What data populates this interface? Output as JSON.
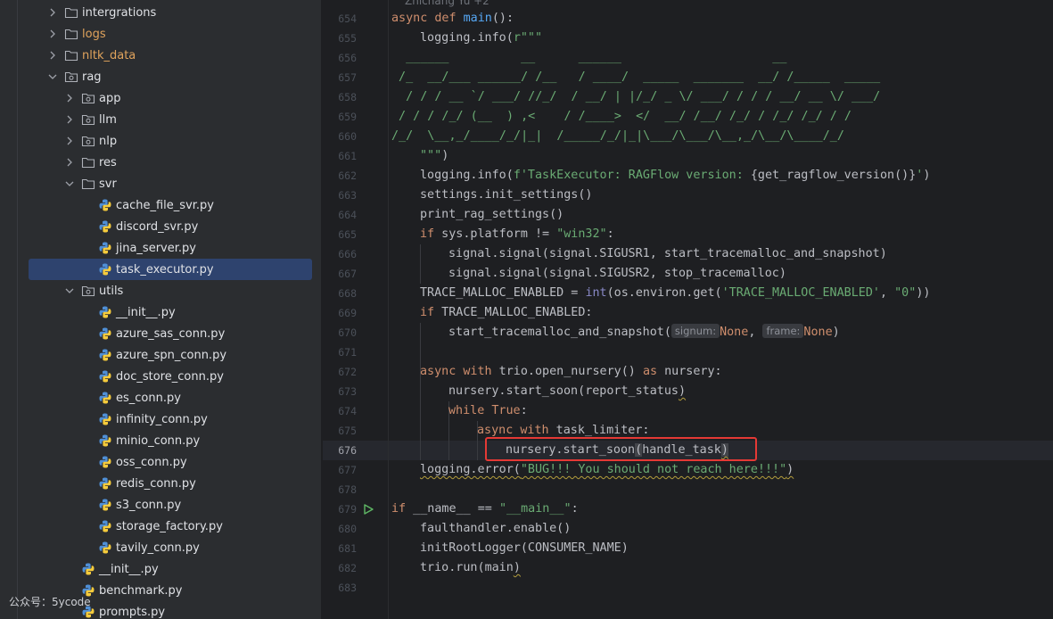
{
  "colors": {
    "sidebar_bg": "#2b2d30",
    "editor_bg": "#1e1f22",
    "selection": "#2e436e",
    "keyword": "#cf8e6d",
    "function": "#56a8f5",
    "string": "#6aab73",
    "highlight_box": "#e53935"
  },
  "sidebar": {
    "items": [
      {
        "label": "intergrations",
        "type": "folder",
        "expanded": false
      },
      {
        "label": "logs",
        "type": "folder",
        "expanded": false
      },
      {
        "label": "nltk_data",
        "type": "folder",
        "expanded": false
      },
      {
        "label": "rag",
        "type": "package",
        "expanded": true
      },
      {
        "label": "app",
        "type": "package",
        "expanded": false
      },
      {
        "label": "llm",
        "type": "package",
        "expanded": false
      },
      {
        "label": "nlp",
        "type": "package",
        "expanded": false
      },
      {
        "label": "res",
        "type": "folder",
        "expanded": false
      },
      {
        "label": "svr",
        "type": "folder",
        "expanded": true
      },
      {
        "label": "cache_file_svr.py",
        "type": "python-file"
      },
      {
        "label": "discord_svr.py",
        "type": "python-file"
      },
      {
        "label": "jina_server.py",
        "type": "python-file"
      },
      {
        "label": "task_executor.py",
        "type": "python-file",
        "selected": true
      },
      {
        "label": "utils",
        "type": "package",
        "expanded": true
      },
      {
        "label": "__init__.py",
        "type": "python-file"
      },
      {
        "label": "azure_sas_conn.py",
        "type": "python-file"
      },
      {
        "label": "azure_spn_conn.py",
        "type": "python-file"
      },
      {
        "label": "doc_store_conn.py",
        "type": "python-file"
      },
      {
        "label": "es_conn.py",
        "type": "python-file"
      },
      {
        "label": "infinity_conn.py",
        "type": "python-file"
      },
      {
        "label": "minio_conn.py",
        "type": "python-file"
      },
      {
        "label": "oss_conn.py",
        "type": "python-file"
      },
      {
        "label": "redis_conn.py",
        "type": "python-file"
      },
      {
        "label": "s3_conn.py",
        "type": "python-file"
      },
      {
        "label": "storage_factory.py",
        "type": "python-file"
      },
      {
        "label": "tavily_conn.py",
        "type": "python-file"
      },
      {
        "label": "__init__.py",
        "type": "python-file"
      },
      {
        "label": "benchmark.py",
        "type": "python-file"
      },
      {
        "label": "prompts.py",
        "type": "python-file"
      }
    ]
  },
  "editor": {
    "author_hint": "Zhichang Yu +2",
    "current_line": "676",
    "line_numbers": [
      "654",
      "655",
      "656",
      "657",
      "658",
      "659",
      "660",
      "661",
      "662",
      "663",
      "664",
      "665",
      "666",
      "667",
      "668",
      "669",
      "670",
      "671",
      "672",
      "673",
      "674",
      "675",
      "676",
      "677",
      "678",
      "679",
      "680",
      "681",
      "682",
      "683"
    ],
    "code": {
      "l654": [
        "async",
        " ",
        "def",
        " ",
        "main",
        "():"
      ],
      "l655": [
        "logging.info(",
        "r\"\"\""
      ],
      "l656": "  ______          __      ______                     __",
      "l657": " /_  __/___ ______/ /__   / ____/  _____  _______  __/ /_____  _____",
      "l658": "  / / / __ `/ ___/ //_/  / __/ | |/_/ _ \\/ ___/ / / / __/ __ \\/ ___/",
      "l659": " / / / /_/ (__  ) ,<    / /____>  </  __/ /__/ /_/ / /_/ /_/ / /",
      "l660": "/_/  \\__,_/____/_/|_|  /_____/_/|_|\\___/\\___/\\__,_/\\__/\\____/_/",
      "l661": "\"\"\"",
      "l661_close": ")",
      "l662": [
        "logging.info(",
        "f'TaskExecutor: RAGFlow version: ",
        "{get_ragflow_version()}",
        "'",
        ")"
      ],
      "l663": "settings.init_settings()",
      "l664": "print_rag_settings()",
      "l665": [
        "if",
        " sys.platform != ",
        "\"win32\"",
        ":"
      ],
      "l666": "signal.signal(signal.SIGUSR1, start_tracemalloc_and_snapshot)",
      "l667": "signal.signal(signal.SIGUSR2, stop_tracemalloc)",
      "l668": [
        "TRACE_MALLOC_ENABLED = ",
        "int",
        "(os.environ.get(",
        "'TRACE_MALLOC_ENABLED'",
        ", ",
        "\"0\"",
        "))"
      ],
      "l669": [
        "if",
        " TRACE_MALLOC_ENABLED:"
      ],
      "l670": [
        "start_tracemalloc_and_snapshot(",
        "signum:",
        "None",
        ", ",
        "frame:",
        "None",
        ")"
      ],
      "l672": [
        "async",
        " ",
        "with",
        " trio.open_nursery() ",
        "as",
        " nursery:"
      ],
      "l673": [
        "nursery.start_soon(",
        "report_status",
        ")"
      ],
      "l674": [
        "while",
        " ",
        "True",
        ":"
      ],
      "l675": [
        "async",
        " ",
        "with",
        " task_limiter:"
      ],
      "l676": [
        "nursery.start_soon",
        "(",
        "handle_task",
        ")"
      ],
      "l677": [
        "logging.error(",
        "\"BUG!!! You should not reach here!!!\"",
        ")"
      ],
      "l679": [
        "if",
        " __name__ == ",
        "\"__main__\"",
        ":"
      ],
      "l680": "faulthandler.enable()",
      "l681": "initRootLogger(CONSUMER_NAME)",
      "l682": [
        "trio.run(",
        "main",
        ")"
      ]
    }
  },
  "watermark": "公众号：5ycode"
}
